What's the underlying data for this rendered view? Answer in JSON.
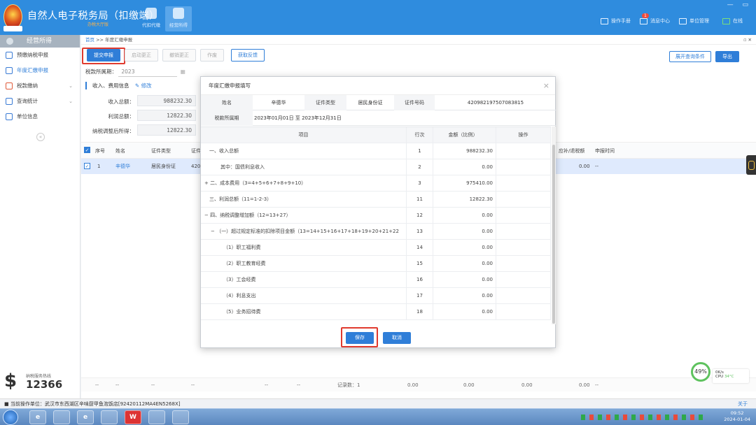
{
  "app": {
    "title": "自然人电子税务局（扣缴端）",
    "subtitle": "办税大厅版",
    "nav": [
      {
        "label": "代扣代缴"
      },
      {
        "label": "经营所得"
      }
    ],
    "top_right": {
      "manual": "操作手册",
      "messages": "消息中心",
      "messages_badge": "1",
      "unit_mgmt": "单位管理",
      "online": "在线"
    },
    "window_controls": "— ▭"
  },
  "sidebar": {
    "header": "经营所得",
    "items": [
      {
        "label": "预缴纳税申报",
        "chevron": ""
      },
      {
        "label": "年度汇缴申报",
        "chevron": ""
      },
      {
        "label": "税款缴纳",
        "chevron": "⌄"
      },
      {
        "label": "查询统计",
        "chevron": "⌄"
      },
      {
        "label": "单位信息",
        "chevron": ""
      }
    ],
    "collapse": "«",
    "brand_small": "纳税服务热线",
    "brand_number": "12366"
  },
  "breadcrumb": {
    "home": "首页",
    "sep": ">>",
    "current": "年度汇缴申报",
    "pin": "▫ ✕"
  },
  "toolbar": {
    "submit": "提交申报",
    "start_correct": "启动更正",
    "cancel_correct": "撤销更正",
    "void": "作废",
    "feedback": "获取反馈",
    "expand_query": "展开查询条件",
    "export": "导出"
  },
  "period": {
    "label": "税款所属期：",
    "value": "2023"
  },
  "income_section": {
    "title": "收入、费用信息",
    "edit": "修改",
    "rows": [
      {
        "label": "收入总额：",
        "value": "988232.30"
      },
      {
        "label": "利润总额：",
        "value": "12822.30"
      },
      {
        "label": "纳税调整后所得：",
        "value": "12822.30"
      }
    ]
  },
  "grid": {
    "headers": {
      "seq": "序号",
      "name": "姓名",
      "id_type": "证件类型",
      "id_no": "证件",
      "refund": "应补/退税额",
      "decl_time": "申报时间"
    },
    "row": {
      "seq": "1",
      "name": "辛德华",
      "id_type": "居民身份证",
      "id_no": "420",
      "refund": "0.00",
      "decl_time": "--"
    },
    "footer": {
      "c1": "--",
      "c2": "--",
      "c3": "--",
      "c4": "--",
      "c5": "--",
      "c6": "--",
      "count": "记录数：1",
      "v1": "0.00",
      "v2": "0.00",
      "v3": "0.00",
      "v4": "0.00",
      "v5": "--"
    }
  },
  "modal": {
    "title": "年度汇缴申报填写",
    "close": "×",
    "info": {
      "name_label": "姓名",
      "name": "辛德华",
      "id_type_label": "证件类型",
      "id_type": "居民身份证",
      "id_no_label": "证件号码",
      "id_no": "420982197507083815",
      "period_label": "税款所属期",
      "period": "2023年01月01日 至 2023年12月31日"
    },
    "table_head": {
      "item": "项目",
      "line": "行次",
      "amount": "金额（比例）",
      "op": "操作"
    },
    "rows": [
      {
        "item": "一、收入总额",
        "line": "1",
        "amount": "988232.30"
      },
      {
        "item": "其中：国债利息收入",
        "line": "2",
        "amount": "0.00"
      },
      {
        "item": "+ 二、成本费用（3=4+5+6+7+8+9+10）",
        "line": "3",
        "amount": "975410.00"
      },
      {
        "item": "三、利润总额（11=1-2-3）",
        "line": "11",
        "amount": "12822.30"
      },
      {
        "item": "− 四、纳税调整增加额（12=13+27）",
        "line": "12",
        "amount": "0.00"
      },
      {
        "item": "− （一）超过规定标准的扣除项目金额（13=14+15+16+17+18+19+20+21+22",
        "line": "13",
        "amount": "0.00"
      },
      {
        "item": "（1）职工福利费",
        "line": "14",
        "amount": "0.00"
      },
      {
        "item": "（2）职工教育经费",
        "line": "15",
        "amount": "0.00"
      },
      {
        "item": "（3）工会经费",
        "line": "16",
        "amount": "0.00"
      },
      {
        "item": "（4）利息支出",
        "line": "17",
        "amount": "0.00"
      },
      {
        "item": "（5）业务招待费",
        "line": "18",
        "amount": "0.00"
      }
    ],
    "save": "保存",
    "cancel": "取消"
  },
  "gauge": {
    "value": "49%",
    "net": "0K/s",
    "cpu": "CPU",
    "temp": "34°C"
  },
  "statusbar": {
    "text": "当前操作单位：武汉市东西湖区辛味厨甲鱼泡饭店[92420112MA4EN5268X]",
    "close": "关于"
  },
  "taskbar": {
    "clock_time": "09:52",
    "clock_date": "2024-01-04"
  },
  "colors": {
    "accent": "#2f7ed8",
    "titlebar": "#2f8cde",
    "highlight": "#e03a2e"
  }
}
